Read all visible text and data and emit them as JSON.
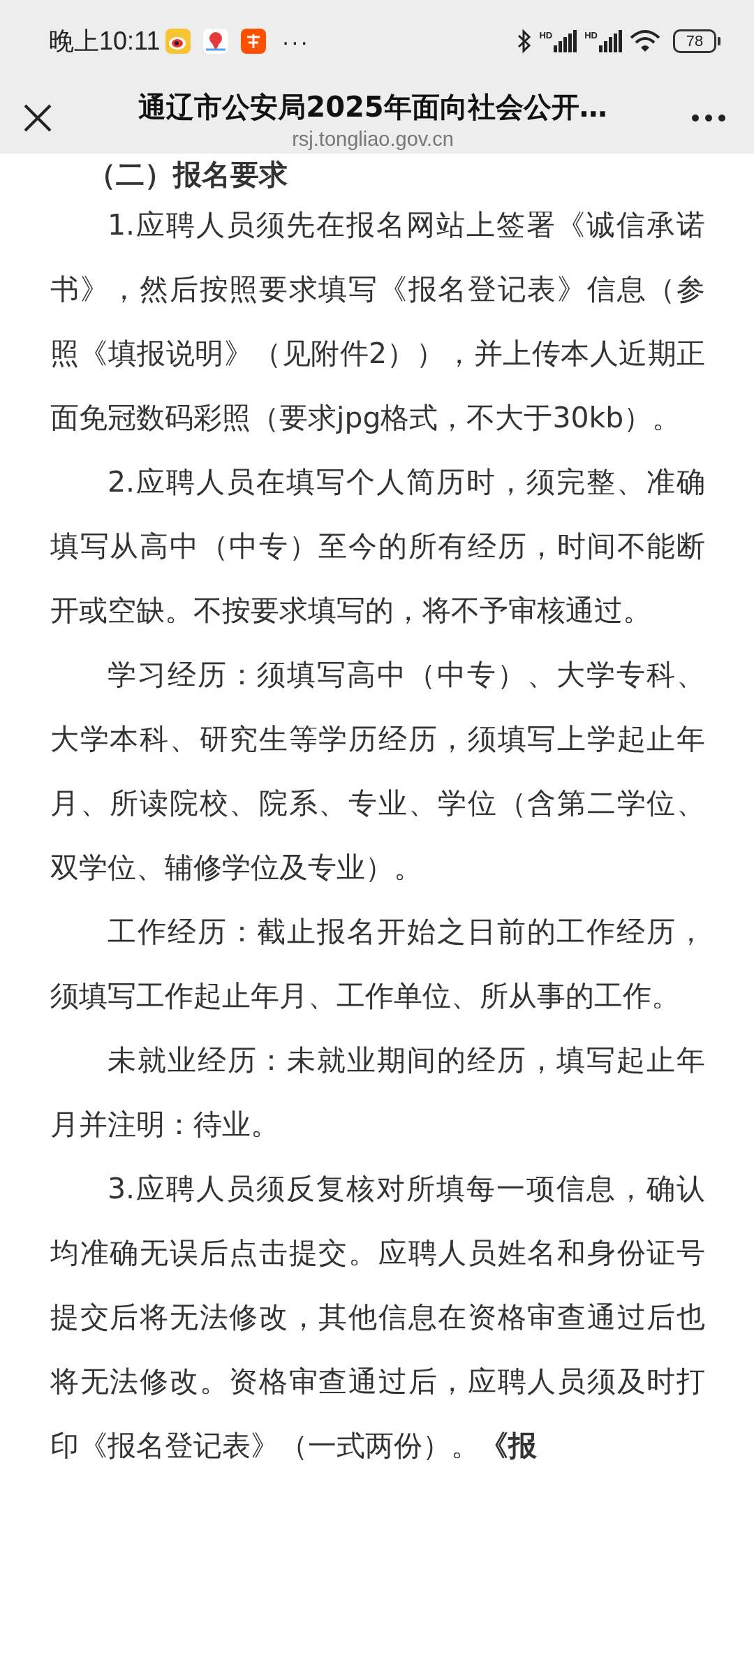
{
  "status_bar": {
    "time": "晚上10:11",
    "more": "···",
    "signals": [
      {
        "label": "HD"
      },
      {
        "label": "HD"
      }
    ],
    "battery": "78"
  },
  "browser_bar": {
    "title": "通辽市公安局2025年面向社会公开…",
    "url": "rsj.tongliao.gov.cn"
  },
  "article": [
    {
      "kind": "heading",
      "text": "（二）报名要求"
    },
    {
      "kind": "paragraph",
      "text": "1.应聘人员须先在报名网站上签署《诚信承诺书》，然后按照要求填写《报名登记表》信息（参照《填报说明》（见附件2）），并上传本人近期正面免冠数码彩照（要求jpg格式，不大于30kb）。"
    },
    {
      "kind": "paragraph",
      "text": "2.应聘人员在填写个人简历时，须完整、准确填写从高中（中专）至今的所有经历，时间不能断开或空缺。不按要求填写的，将不予审核通过。"
    },
    {
      "kind": "paragraph",
      "text": "学习经历：须填写高中（中专）、大学专科、大学本科、研究生等学历经历，须填写上学起止年月、所读院校、院系、专业、学位（含第二学位、双学位、辅修学位及专业）。"
    },
    {
      "kind": "paragraph",
      "text": "工作经历：截止报名开始之日前的工作经历，须填写工作起止年月、工作单位、所从事的工作。"
    },
    {
      "kind": "paragraph",
      "text": "未就业经历：未就业期间的经历，填写起止年月并注明：待业。"
    },
    {
      "kind": "paragraph",
      "text": "3.应聘人员须反复核对所填每一项信息，确认均准确无误后点击提交。应聘人员姓名和身份证号提交后将无法修改，其他信息在资格审查通过后也将无法修改。资格审查通过后，应聘人员须及时打印《报名登记表》（一式两份）。**《报**"
    }
  ]
}
